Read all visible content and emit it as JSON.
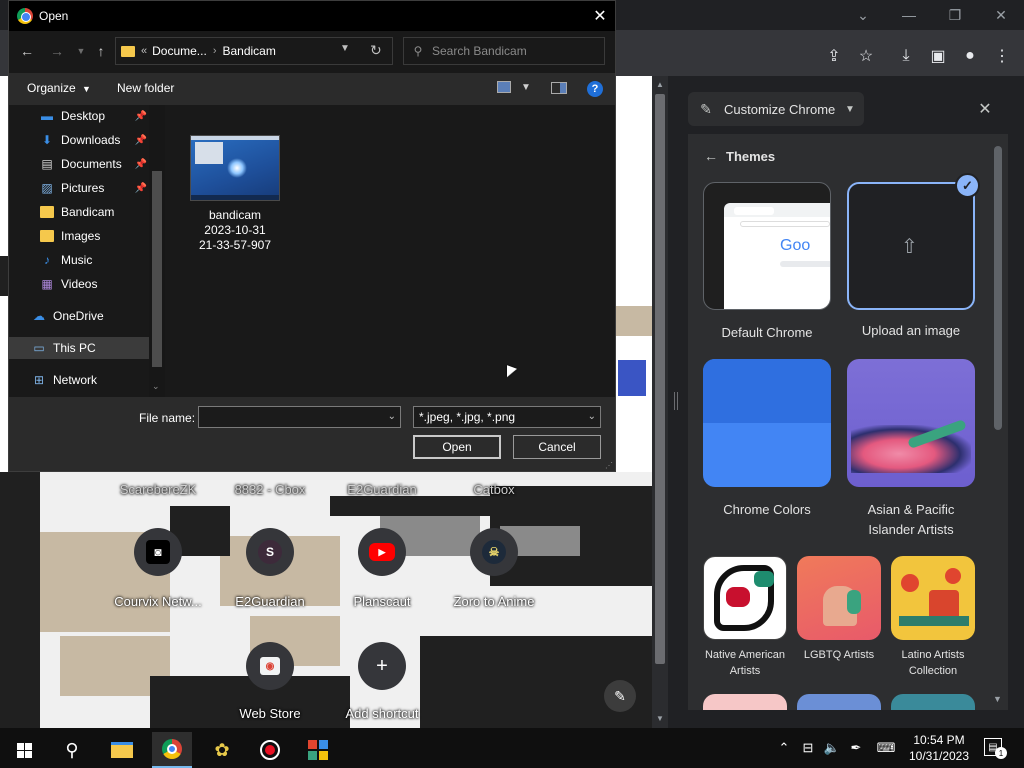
{
  "dialog": {
    "title": "Open",
    "address": {
      "parent": "Docume...",
      "current": "Bandicam"
    },
    "search_placeholder": "Search Bandicam",
    "commands": {
      "organize": "Organize",
      "new_folder": "New folder"
    },
    "nav_items": [
      {
        "label": "Desktop",
        "icon": "desktop-icon",
        "pinned": true
      },
      {
        "label": "Downloads",
        "icon": "downloads-icon",
        "pinned": true
      },
      {
        "label": "Documents",
        "icon": "documents-icon",
        "pinned": true
      },
      {
        "label": "Pictures",
        "icon": "pictures-icon",
        "pinned": true
      },
      {
        "label": "Bandicam",
        "icon": "folder-icon",
        "pinned": false
      },
      {
        "label": "Images",
        "icon": "folder-icon",
        "pinned": false
      },
      {
        "label": "Music",
        "icon": "music-icon",
        "pinned": false
      },
      {
        "label": "Videos",
        "icon": "videos-icon",
        "pinned": false
      },
      {
        "label": "OneDrive",
        "icon": "onedrive-icon",
        "pinned": false
      },
      {
        "label": "This PC",
        "icon": "this-pc-icon",
        "pinned": false,
        "selected": true
      },
      {
        "label": "Network",
        "icon": "network-icon",
        "pinned": false
      }
    ],
    "file": {
      "line1": "bandicam",
      "line2": "2023-10-31",
      "line3": "21-33-57-907"
    },
    "filename_label": "File name:",
    "filename_value": "",
    "filetype": "*.jpeg, *.jpg, *.png",
    "open_label": "Open",
    "cancel_label": "Cancel"
  },
  "ntp": {
    "top_labels": [
      "ScarebereZK",
      "8832 - Cbox",
      "E2Guardian",
      "Catbox"
    ],
    "shortcuts": [
      {
        "label": "Courvix Netw...",
        "icon": "courvix-icon"
      },
      {
        "label": "E2Guardian",
        "icon": "e2guardian-icon",
        "letter": "S"
      },
      {
        "label": "Planscaut",
        "icon": "youtube-icon"
      },
      {
        "label": "Zoro to Anime",
        "icon": "zoro-icon"
      },
      {
        "label": "Web Store",
        "icon": "web-store-icon"
      },
      {
        "label": "Add shortcut",
        "icon": "plus-icon"
      }
    ]
  },
  "customize_panel": {
    "header": "Customize Chrome",
    "section": "Themes",
    "themes": [
      {
        "label": "Default Chrome",
        "preview_text": "Goo"
      },
      {
        "label": "Upload an image",
        "selected": true
      },
      {
        "label": "Chrome Colors"
      },
      {
        "label_line1": "Asian & Pacific",
        "label_line2": "Islander Artists"
      },
      {
        "label_line1": "Native American",
        "label_line2": "Artists"
      },
      {
        "label_line1": "LGBTQ Artists",
        "label_line2": ""
      },
      {
        "label_line1": "Latino Artists",
        "label_line2": "Collection"
      }
    ]
  },
  "taskbar": {
    "time": "10:54 PM",
    "date": "10/31/2023",
    "notification_count": "1"
  },
  "colors": {
    "accent_blue": "#8ab4f8",
    "chrome_colors_top": "#2f6fe0",
    "chrome_colors_bottom": "#4285f4",
    "dialog_bg": "#2b2b2b",
    "folder_yellow": "#f5c84c"
  }
}
